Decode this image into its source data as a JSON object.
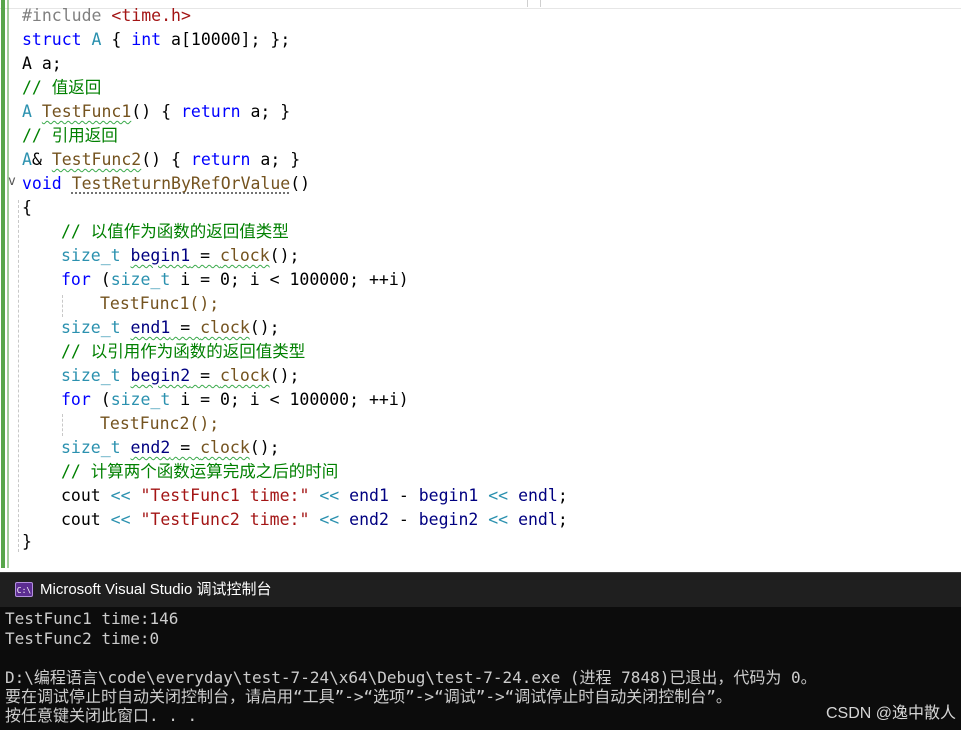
{
  "editor": {
    "header": {
      "text": "#include ",
      "inc": "<time.h>"
    },
    "struct": {
      "kw": "struct",
      "name": "A",
      "open": " { ",
      "type": "int",
      "rest": " a[10000]; };"
    },
    "decl": "A a;",
    "comment1": "// 值返回",
    "func1": {
      "type": "A",
      "name": "TestFunc1",
      "body_open": "() { ",
      "kw_return": "return",
      "body_close": " a; }"
    },
    "comment2": "// 引用返回",
    "func2": {
      "type": "A",
      "amp": "& ",
      "name": "TestFunc2",
      "body_open": "() { ",
      "kw_return": "return",
      "body_close": " a; }"
    },
    "main_sig": {
      "kw": "void",
      "name": "TestReturnByRefOrValue",
      "parens": "()"
    },
    "brace_open": "{",
    "comment3": "// 以值作为函数的返回值类型",
    "begin1": {
      "type": "size_t",
      "var": "begin1",
      "eq": " = ",
      "call": "clock",
      "tail": "();"
    },
    "for1": {
      "kw": "for",
      "open": " (",
      "type": "size_t",
      "rest": " i = 0; i < 100000; ++i)"
    },
    "call1": "TestFunc1();",
    "end1": {
      "type": "size_t",
      "var": "end1",
      "eq": " = ",
      "call": "clock",
      "tail": "();"
    },
    "comment4": "// 以引用作为函数的返回值类型",
    "begin2": {
      "type": "size_t",
      "var": "begin2",
      "eq": " = ",
      "call": "clock",
      "tail": "();"
    },
    "for2": {
      "kw": "for",
      "open": " (",
      "type": "size_t",
      "rest": " i = 0; i < 100000; ++i)"
    },
    "call2": "TestFunc2();",
    "end2": {
      "type": "size_t",
      "var": "end2",
      "eq": " = ",
      "call": "clock",
      "tail": "();"
    },
    "comment5": "// 计算两个函数运算完成之后的时间",
    "cout1": {
      "a": "cout",
      "op1": " << ",
      "str": "\"TestFunc1 time:\"",
      "op2": " << ",
      "v1": "end1",
      "minus": " - ",
      "v2": "begin1",
      "op3": " << ",
      "endl": "endl",
      "semi": ";"
    },
    "cout2": {
      "a": "cout",
      "op1": " << ",
      "str": "\"TestFunc2 time:\"",
      "op2": " << ",
      "v1": "end2",
      "minus": " - ",
      "v2": "begin2",
      "op3": " << ",
      "endl": "endl",
      "semi": ";"
    },
    "brace_close": "}",
    "fold_glyph": "v"
  },
  "console": {
    "icon_label": "C:\\",
    "title": "Microsoft Visual Studio 调试控制台",
    "lines": [
      "TestFunc1 time:146",
      "TestFunc2 time:0",
      "",
      "D:\\编程语言\\code\\everyday\\test-7-24\\x64\\Debug\\test-7-24.exe (进程 7848)已退出，代码为 0。",
      "要在调试停止时自动关闭控制台，请启用“工具”->“选项”->“调试”->“调试停止时自动关闭控制台”。",
      "按任意键关闭此窗口. . ."
    ]
  },
  "watermark": "CSDN @逸中散人",
  "colors": {
    "keyword": "#0000ff",
    "type": "#2b91af",
    "comment": "#008000",
    "string": "#a31515",
    "preprocessor": "#808080",
    "console_bg": "#0c0c0c",
    "console_fg": "#cccccc",
    "change_bar": "#57a64a"
  }
}
